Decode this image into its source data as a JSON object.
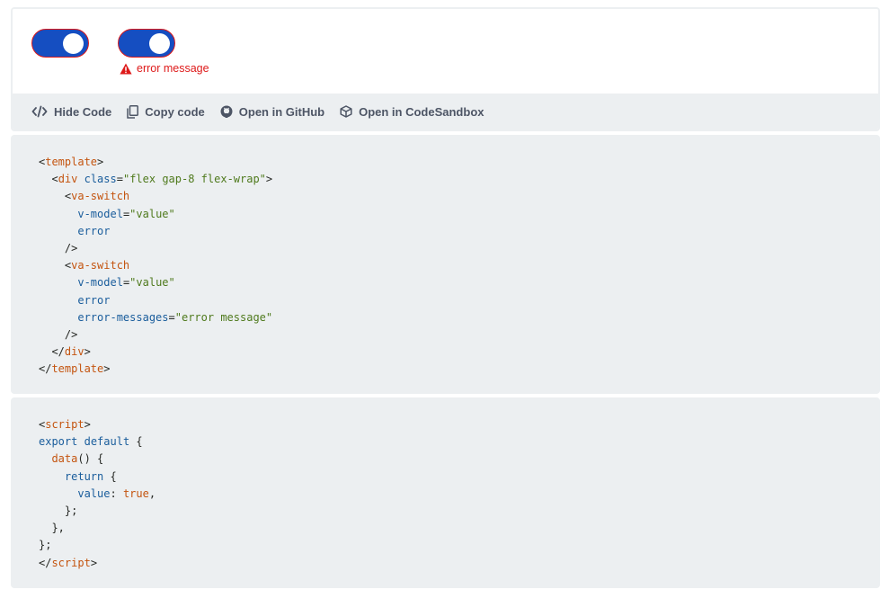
{
  "preview": {
    "switches": [
      {
        "checked": true,
        "error": true
      },
      {
        "checked": true,
        "error": true
      }
    ],
    "error_message": "error message"
  },
  "toolbar": {
    "hide_code": "Hide Code",
    "copy_code": "Copy code",
    "open_github": "Open in GitHub",
    "open_codesandbox": "Open in CodeSandbox"
  },
  "code_template": [
    [
      {
        "t": "p",
        "v": "<"
      },
      {
        "t": "tag",
        "v": "template"
      },
      {
        "t": "p",
        "v": ">"
      }
    ],
    [
      {
        "t": "p",
        "v": "  <"
      },
      {
        "t": "tag",
        "v": "div"
      },
      {
        "t": "p",
        "v": " "
      },
      {
        "t": "attr",
        "v": "class"
      },
      {
        "t": "p",
        "v": "="
      },
      {
        "t": "str",
        "v": "\"flex gap-8 flex-wrap\""
      },
      {
        "t": "p",
        "v": ">"
      }
    ],
    [
      {
        "t": "p",
        "v": "    <"
      },
      {
        "t": "tag",
        "v": "va-switch"
      }
    ],
    [
      {
        "t": "p",
        "v": "      "
      },
      {
        "t": "attr",
        "v": "v-model"
      },
      {
        "t": "p",
        "v": "="
      },
      {
        "t": "str",
        "v": "\"value\""
      }
    ],
    [
      {
        "t": "p",
        "v": "      "
      },
      {
        "t": "attr",
        "v": "error"
      }
    ],
    [
      {
        "t": "p",
        "v": "    />"
      }
    ],
    [
      {
        "t": "p",
        "v": "    <"
      },
      {
        "t": "tag",
        "v": "va-switch"
      }
    ],
    [
      {
        "t": "p",
        "v": "      "
      },
      {
        "t": "attr",
        "v": "v-model"
      },
      {
        "t": "p",
        "v": "="
      },
      {
        "t": "str",
        "v": "\"value\""
      }
    ],
    [
      {
        "t": "p",
        "v": "      "
      },
      {
        "t": "attr",
        "v": "error"
      }
    ],
    [
      {
        "t": "p",
        "v": "      "
      },
      {
        "t": "attr",
        "v": "error-messages"
      },
      {
        "t": "p",
        "v": "="
      },
      {
        "t": "str",
        "v": "\"error message\""
      }
    ],
    [
      {
        "t": "p",
        "v": "    />"
      }
    ],
    [
      {
        "t": "p",
        "v": "  </"
      },
      {
        "t": "tag",
        "v": "div"
      },
      {
        "t": "p",
        "v": ">"
      }
    ],
    [
      {
        "t": "p",
        "v": "</"
      },
      {
        "t": "tag",
        "v": "template"
      },
      {
        "t": "p",
        "v": ">"
      }
    ]
  ],
  "code_script": [
    [
      {
        "t": "p",
        "v": "<"
      },
      {
        "t": "tag",
        "v": "script"
      },
      {
        "t": "p",
        "v": ">"
      }
    ],
    [
      {
        "t": "kw",
        "v": "export"
      },
      {
        "t": "p",
        "v": " "
      },
      {
        "t": "kw",
        "v": "default"
      },
      {
        "t": "p",
        "v": " {"
      }
    ],
    [
      {
        "t": "p",
        "v": "  "
      },
      {
        "t": "fn",
        "v": "data"
      },
      {
        "t": "p",
        "v": "() {"
      }
    ],
    [
      {
        "t": "p",
        "v": "    "
      },
      {
        "t": "kw",
        "v": "return"
      },
      {
        "t": "p",
        "v": " {"
      }
    ],
    [
      {
        "t": "p",
        "v": "      "
      },
      {
        "t": "attr",
        "v": "value"
      },
      {
        "t": "p",
        "v": ": "
      },
      {
        "t": "fn",
        "v": "true"
      },
      {
        "t": "p",
        "v": ","
      }
    ],
    [
      {
        "t": "p",
        "v": "    };"
      }
    ],
    [
      {
        "t": "p",
        "v": "  },"
      }
    ],
    [
      {
        "t": "p",
        "v": "};"
      }
    ],
    [
      {
        "t": "p",
        "v": "</"
      },
      {
        "t": "tag",
        "v": "script"
      },
      {
        "t": "p",
        "v": ">"
      }
    ]
  ]
}
